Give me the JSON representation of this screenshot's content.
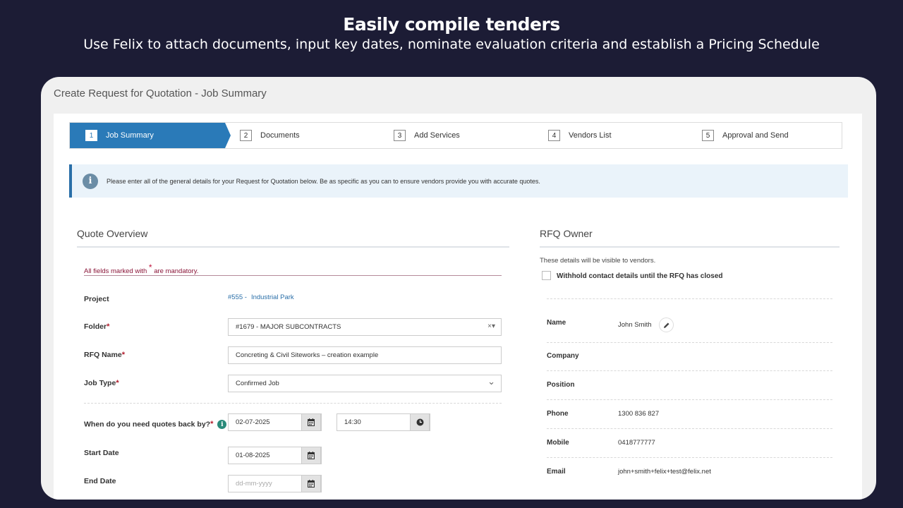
{
  "hero": {
    "title": "Easily compile tenders",
    "subtitle": "Use Felix to attach documents, input key dates, nominate evaluation criteria and establish a Pricing Schedule"
  },
  "window": {
    "title": "Create Request for Quotation - Job Summary"
  },
  "steps": [
    {
      "num": "1",
      "label": "Job Summary"
    },
    {
      "num": "2",
      "label": "Documents"
    },
    {
      "num": "3",
      "label": "Add Services"
    },
    {
      "num": "4",
      "label": "Vendors List"
    },
    {
      "num": "5",
      "label": "Approval and Send"
    }
  ],
  "info": {
    "icon": "info-icon",
    "text": "Please enter all of the general details for your Request for Quotation below. Be as specific as you can to ensure vendors provide you with accurate quotes."
  },
  "overview": {
    "title": "Quote Overview",
    "mandatory_prefix": "All fields marked with",
    "mandatory_star": "*",
    "mandatory_suffix": "are mandatory.",
    "project_label": "Project",
    "project_number": "#555 -",
    "project_name": "Industrial Park",
    "folder_label": "Folder",
    "folder_value": "#1679 - MAJOR SUBCONTRACTS",
    "folder_clear": "×▾",
    "rfq_name_label": "RFQ Name",
    "rfq_name_value": "Concreting & Civil Siteworks – creation example",
    "job_type_label": "Job Type",
    "job_type_value": "Confirmed Job",
    "job_type_caret": "⌄",
    "quotes_back_label": "When do you need quotes back by?",
    "quotes_back_date": "02-07-2025",
    "quotes_back_time": "14:30",
    "start_label": "Start Date",
    "start_value": "01-08-2025",
    "end_label": "End Date",
    "end_placeholder": "dd-mm-yyyy",
    "required_star": "*"
  },
  "owner": {
    "title": "RFQ Owner",
    "note": "These details will be visible to vendors.",
    "withhold_label": "Withhold contact details until the RFQ has closed",
    "name_label": "Name",
    "name_value": "John Smith",
    "company_label": "Company",
    "position_label": "Position",
    "phone_label": "Phone",
    "phone_value": "1300 836 827",
    "mobile_label": "Mobile",
    "mobile_value": "0418777777",
    "email_label": "Email",
    "email_value": "john+smith+felix+test@felix.net"
  },
  "colors": {
    "accent": "#2a7ab8",
    "background": "#1c1c35",
    "mandatory": "#8a1538"
  }
}
